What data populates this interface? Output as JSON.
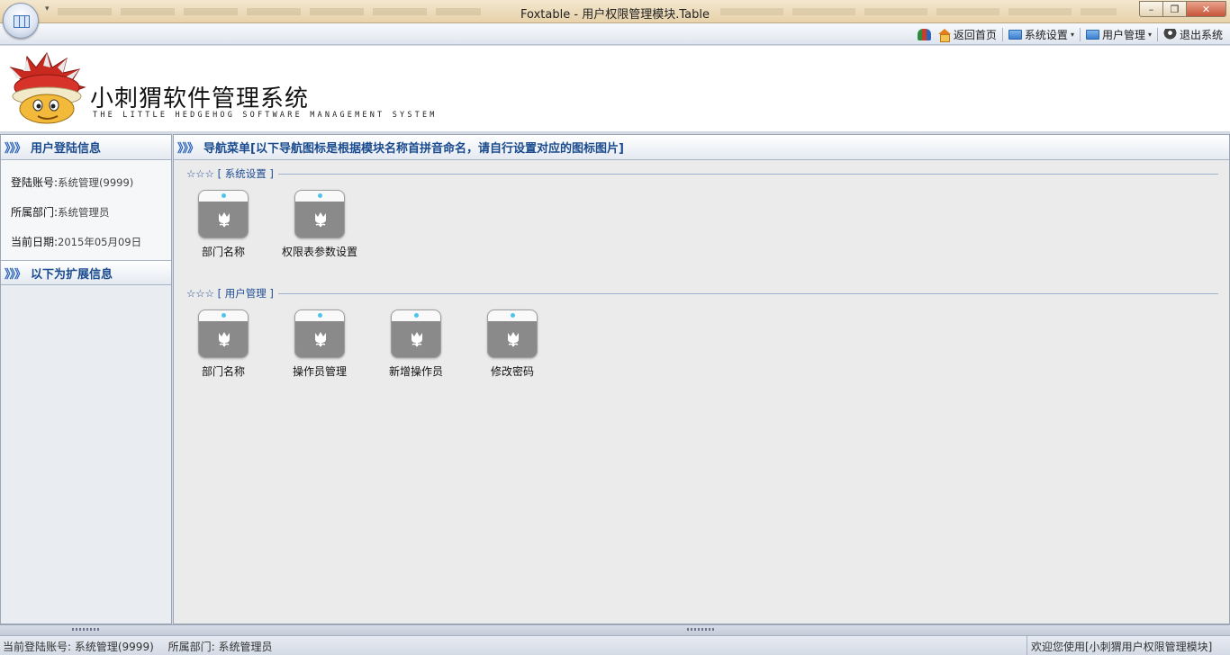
{
  "window": {
    "title": "Foxtable - 用户权限管理模块.Table",
    "qat_arrow": "▾",
    "minimize": "–",
    "maximize": "❐",
    "close": "✕"
  },
  "menu": {
    "items": [
      {
        "label": "返回首页",
        "icon": "home-icon",
        "dropdown": false
      },
      {
        "label": "系统设置",
        "icon": "folder-icon",
        "dropdown": true
      },
      {
        "label": "用户管理",
        "icon": "folder-icon",
        "dropdown": true
      },
      {
        "label": "退出系统",
        "icon": "exit-icon",
        "dropdown": false
      }
    ],
    "dropdown_caret": "▾"
  },
  "header": {
    "title": "小刺猬软件管理系统",
    "subtitle": "THE LITTLE HEDGEHOG SOFTWARE MANAGEMENT SYSTEM"
  },
  "left": {
    "chevrons": "》》》",
    "login_title": "用户登陆信息",
    "account_label": "登陆账号:",
    "account_value": "系统管理(9999)",
    "dept_label": "所属部门:",
    "dept_value": "系统管理员",
    "date_label": "当前日期:",
    "date_value": "2015年05月09日",
    "ext_title": "以下为扩展信息"
  },
  "right": {
    "chevrons": "》》》",
    "nav_title": "导航菜单[以下导航图标是根据模块名称首拼音命名，请自行设置对应的图标图片]",
    "groups": [
      {
        "title": "☆☆☆ [ 系统设置 ]",
        "items": [
          "部门名称",
          "权限表参数设置"
        ]
      },
      {
        "title": "☆☆☆ [ 用户管理 ]",
        "items": [
          "部门名称",
          "操作员管理",
          "新增操作员",
          "修改密码"
        ]
      }
    ]
  },
  "status": {
    "account": "当前登陆账号: 系统管理(9999)",
    "dept": "所属部门: 系统管理员",
    "welcome": "欢迎您使用[小刺猬用户权限管理模块]"
  },
  "colors": {
    "accent": "#1a4b8e",
    "group_title": "#1f4d94",
    "icon_dot": "#4ec4ea"
  }
}
